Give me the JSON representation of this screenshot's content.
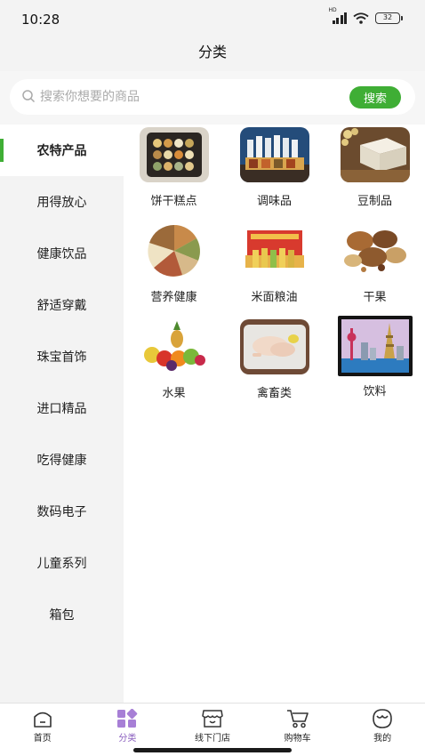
{
  "status_bar": {
    "time": "10:28",
    "network_label": "HD",
    "battery": "32"
  },
  "header": {
    "title": "分类"
  },
  "search": {
    "placeholder": "搜索你想要的商品",
    "button_label": "搜索"
  },
  "sidebar": {
    "items": [
      {
        "label": "农特产品",
        "active": true
      },
      {
        "label": "用得放心"
      },
      {
        "label": "健康饮品"
      },
      {
        "label": "舒适穿戴"
      },
      {
        "label": "珠宝首饰"
      },
      {
        "label": "进口精品"
      },
      {
        "label": "吃得健康"
      },
      {
        "label": "数码电子"
      },
      {
        "label": "儿童系列"
      },
      {
        "label": "箱包"
      }
    ]
  },
  "categories": [
    {
      "label": "饼干糕点",
      "icon": "pastry-tray-image"
    },
    {
      "label": "调味品",
      "icon": "condiment-bottles-image"
    },
    {
      "label": "豆制品",
      "icon": "tofu-image"
    },
    {
      "label": "营养健康",
      "icon": "grain-platter-image"
    },
    {
      "label": "米面粮油",
      "icon": "oil-gift-box-image"
    },
    {
      "label": "干果",
      "icon": "dried-fruit-image"
    },
    {
      "label": "水果",
      "icon": "fruit-basket-image"
    },
    {
      "label": "禽畜类",
      "icon": "poultry-image"
    },
    {
      "label": "饮料",
      "icon": "city-skyline-image"
    }
  ],
  "tabbar": {
    "items": [
      {
        "label": "首页",
        "icon": "home-icon"
      },
      {
        "label": "分类",
        "icon": "category-icon",
        "active": true
      },
      {
        "label": "线下门店",
        "icon": "store-icon"
      },
      {
        "label": "购物车",
        "icon": "cart-icon"
      },
      {
        "label": "我的",
        "icon": "profile-icon"
      }
    ]
  },
  "colors": {
    "accent_green": "#3fae35",
    "active_tab_purple": "#8b5fbf"
  }
}
